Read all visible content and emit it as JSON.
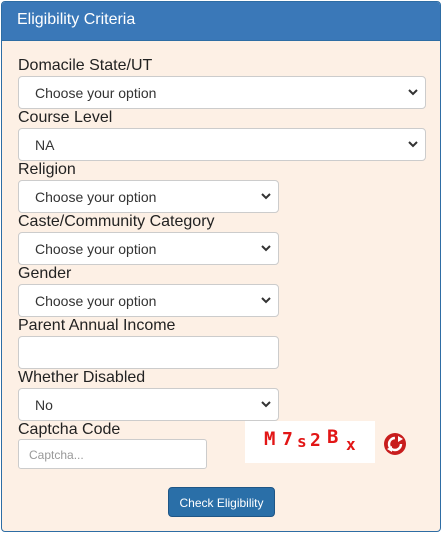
{
  "panel": {
    "title": "Eligibility Criteria"
  },
  "form": {
    "domicile": {
      "label": "Domacile State/UT",
      "value": "Choose your option"
    },
    "course": {
      "label": "Course Level",
      "value": "NA"
    },
    "religion": {
      "label": "Religion",
      "value": "Choose your option"
    },
    "caste": {
      "label": "Caste/Community Category",
      "value": "Choose your option"
    },
    "gender": {
      "label": "Gender",
      "value": "Choose your option"
    },
    "income": {
      "label": "Parent Annual Income",
      "value": ""
    },
    "disabled": {
      "label": "Whether Disabled",
      "value": "No"
    },
    "captcha": {
      "label": "Captcha Code",
      "placeholder": "Captcha...",
      "chars": [
        "M",
        "7",
        "s",
        "2",
        "B",
        "x"
      ]
    },
    "submit_label": "Check Eligibility"
  },
  "colors": {
    "header": "#3a78b8",
    "panel_bg": "#fdf0e5",
    "button": "#2a6fa8",
    "captcha_text": "#e21616"
  },
  "icons": {
    "dropdown": "chevron-down-icon",
    "refresh": "refresh-icon"
  }
}
